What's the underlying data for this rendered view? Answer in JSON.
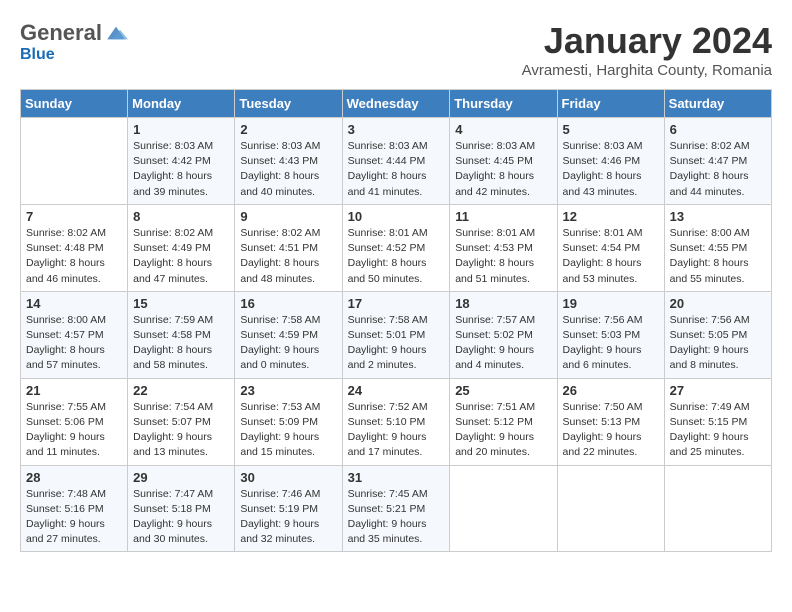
{
  "header": {
    "logo_general": "General",
    "logo_blue": "Blue",
    "month_title": "January 2024",
    "subtitle": "Avramesti, Harghita County, Romania"
  },
  "weekdays": [
    "Sunday",
    "Monday",
    "Tuesday",
    "Wednesday",
    "Thursday",
    "Friday",
    "Saturday"
  ],
  "weeks": [
    [
      {
        "day": "",
        "sunrise": "",
        "sunset": "",
        "daylight": ""
      },
      {
        "day": "1",
        "sunrise": "Sunrise: 8:03 AM",
        "sunset": "Sunset: 4:42 PM",
        "daylight": "Daylight: 8 hours and 39 minutes."
      },
      {
        "day": "2",
        "sunrise": "Sunrise: 8:03 AM",
        "sunset": "Sunset: 4:43 PM",
        "daylight": "Daylight: 8 hours and 40 minutes."
      },
      {
        "day": "3",
        "sunrise": "Sunrise: 8:03 AM",
        "sunset": "Sunset: 4:44 PM",
        "daylight": "Daylight: 8 hours and 41 minutes."
      },
      {
        "day": "4",
        "sunrise": "Sunrise: 8:03 AM",
        "sunset": "Sunset: 4:45 PM",
        "daylight": "Daylight: 8 hours and 42 minutes."
      },
      {
        "day": "5",
        "sunrise": "Sunrise: 8:03 AM",
        "sunset": "Sunset: 4:46 PM",
        "daylight": "Daylight: 8 hours and 43 minutes."
      },
      {
        "day": "6",
        "sunrise": "Sunrise: 8:02 AM",
        "sunset": "Sunset: 4:47 PM",
        "daylight": "Daylight: 8 hours and 44 minutes."
      }
    ],
    [
      {
        "day": "7",
        "sunrise": "Sunrise: 8:02 AM",
        "sunset": "Sunset: 4:48 PM",
        "daylight": "Daylight: 8 hours and 46 minutes."
      },
      {
        "day": "8",
        "sunrise": "Sunrise: 8:02 AM",
        "sunset": "Sunset: 4:49 PM",
        "daylight": "Daylight: 8 hours and 47 minutes."
      },
      {
        "day": "9",
        "sunrise": "Sunrise: 8:02 AM",
        "sunset": "Sunset: 4:51 PM",
        "daylight": "Daylight: 8 hours and 48 minutes."
      },
      {
        "day": "10",
        "sunrise": "Sunrise: 8:01 AM",
        "sunset": "Sunset: 4:52 PM",
        "daylight": "Daylight: 8 hours and 50 minutes."
      },
      {
        "day": "11",
        "sunrise": "Sunrise: 8:01 AM",
        "sunset": "Sunset: 4:53 PM",
        "daylight": "Daylight: 8 hours and 51 minutes."
      },
      {
        "day": "12",
        "sunrise": "Sunrise: 8:01 AM",
        "sunset": "Sunset: 4:54 PM",
        "daylight": "Daylight: 8 hours and 53 minutes."
      },
      {
        "day": "13",
        "sunrise": "Sunrise: 8:00 AM",
        "sunset": "Sunset: 4:55 PM",
        "daylight": "Daylight: 8 hours and 55 minutes."
      }
    ],
    [
      {
        "day": "14",
        "sunrise": "Sunrise: 8:00 AM",
        "sunset": "Sunset: 4:57 PM",
        "daylight": "Daylight: 8 hours and 57 minutes."
      },
      {
        "day": "15",
        "sunrise": "Sunrise: 7:59 AM",
        "sunset": "Sunset: 4:58 PM",
        "daylight": "Daylight: 8 hours and 58 minutes."
      },
      {
        "day": "16",
        "sunrise": "Sunrise: 7:58 AM",
        "sunset": "Sunset: 4:59 PM",
        "daylight": "Daylight: 9 hours and 0 minutes."
      },
      {
        "day": "17",
        "sunrise": "Sunrise: 7:58 AM",
        "sunset": "Sunset: 5:01 PM",
        "daylight": "Daylight: 9 hours and 2 minutes."
      },
      {
        "day": "18",
        "sunrise": "Sunrise: 7:57 AM",
        "sunset": "Sunset: 5:02 PM",
        "daylight": "Daylight: 9 hours and 4 minutes."
      },
      {
        "day": "19",
        "sunrise": "Sunrise: 7:56 AM",
        "sunset": "Sunset: 5:03 PM",
        "daylight": "Daylight: 9 hours and 6 minutes."
      },
      {
        "day": "20",
        "sunrise": "Sunrise: 7:56 AM",
        "sunset": "Sunset: 5:05 PM",
        "daylight": "Daylight: 9 hours and 8 minutes."
      }
    ],
    [
      {
        "day": "21",
        "sunrise": "Sunrise: 7:55 AM",
        "sunset": "Sunset: 5:06 PM",
        "daylight": "Daylight: 9 hours and 11 minutes."
      },
      {
        "day": "22",
        "sunrise": "Sunrise: 7:54 AM",
        "sunset": "Sunset: 5:07 PM",
        "daylight": "Daylight: 9 hours and 13 minutes."
      },
      {
        "day": "23",
        "sunrise": "Sunrise: 7:53 AM",
        "sunset": "Sunset: 5:09 PM",
        "daylight": "Daylight: 9 hours and 15 minutes."
      },
      {
        "day": "24",
        "sunrise": "Sunrise: 7:52 AM",
        "sunset": "Sunset: 5:10 PM",
        "daylight": "Daylight: 9 hours and 17 minutes."
      },
      {
        "day": "25",
        "sunrise": "Sunrise: 7:51 AM",
        "sunset": "Sunset: 5:12 PM",
        "daylight": "Daylight: 9 hours and 20 minutes."
      },
      {
        "day": "26",
        "sunrise": "Sunrise: 7:50 AM",
        "sunset": "Sunset: 5:13 PM",
        "daylight": "Daylight: 9 hours and 22 minutes."
      },
      {
        "day": "27",
        "sunrise": "Sunrise: 7:49 AM",
        "sunset": "Sunset: 5:15 PM",
        "daylight": "Daylight: 9 hours and 25 minutes."
      }
    ],
    [
      {
        "day": "28",
        "sunrise": "Sunrise: 7:48 AM",
        "sunset": "Sunset: 5:16 PM",
        "daylight": "Daylight: 9 hours and 27 minutes."
      },
      {
        "day": "29",
        "sunrise": "Sunrise: 7:47 AM",
        "sunset": "Sunset: 5:18 PM",
        "daylight": "Daylight: 9 hours and 30 minutes."
      },
      {
        "day": "30",
        "sunrise": "Sunrise: 7:46 AM",
        "sunset": "Sunset: 5:19 PM",
        "daylight": "Daylight: 9 hours and 32 minutes."
      },
      {
        "day": "31",
        "sunrise": "Sunrise: 7:45 AM",
        "sunset": "Sunset: 5:21 PM",
        "daylight": "Daylight: 9 hours and 35 minutes."
      },
      {
        "day": "",
        "sunrise": "",
        "sunset": "",
        "daylight": ""
      },
      {
        "day": "",
        "sunrise": "",
        "sunset": "",
        "daylight": ""
      },
      {
        "day": "",
        "sunrise": "",
        "sunset": "",
        "daylight": ""
      }
    ]
  ]
}
